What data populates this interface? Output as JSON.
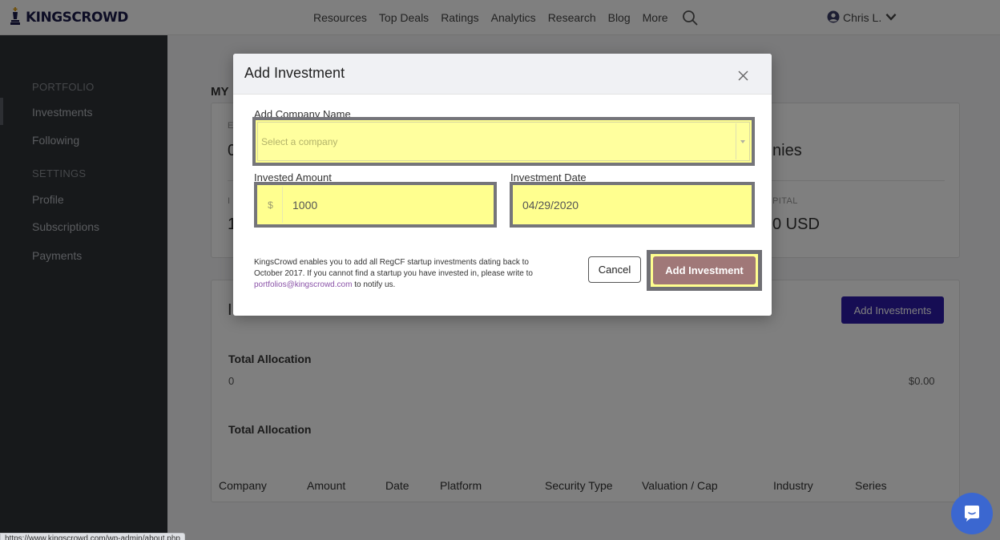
{
  "brand": {
    "logo_text": "KINGSCROWD"
  },
  "nav": {
    "links": [
      "Resources",
      "Top Deals",
      "Ratings",
      "Analytics",
      "Research",
      "Blog",
      "More"
    ],
    "user_name": "Chris L."
  },
  "sidebar": {
    "portfolio_heading": "PORTFOLIO",
    "portfolio_items": [
      "Investments",
      "Following"
    ],
    "settings_heading": "SETTINGS",
    "settings_items": [
      "Profile",
      "Subscriptions",
      "Payments"
    ]
  },
  "main": {
    "heading_partial": "MY",
    "stat1_label_partial": "E",
    "stat1_value_partial": "0",
    "stat2_value_partial": "nies",
    "stat3_label_partial": "I",
    "stat3_value_partial": "1",
    "stat4_label_partial": "PITAL",
    "stat4_value_partial": "0 USD",
    "section_letter": "I",
    "add_investments_label": "Add Investments",
    "total_allocation_1": "Total Allocation",
    "allocation_count": "0",
    "allocation_amount": "$0.00",
    "total_allocation_2": "Total Allocation",
    "table_headers": [
      "Company",
      "Amount",
      "Date",
      "Platform",
      "Security Type",
      "Valuation / Cap",
      "Industry",
      "Series"
    ]
  },
  "modal": {
    "title": "Add Investment",
    "company_label": "Add Company Name",
    "company_placeholder": "Select a company",
    "amount_label": "Invested Amount",
    "amount_prefix": "$",
    "amount_value": "1000",
    "date_label": "Investment Date",
    "date_value": "04/29/2020",
    "note_text": "KingsCrowd enables you to add all RegCF startup investments dating back to October 2017. If you cannot find a startup you have invested in, please write to ",
    "note_email": "portfolios@kingscrowd.com",
    "note_suffix": " to notify us.",
    "cancel_label": "Cancel",
    "submit_label": "Add Investment"
  },
  "status_url": "https://www.kingscrowd.com/wp-admin/about.php",
  "colors": {
    "highlight": "#ffff8f",
    "primary_button": "#2c1ba8",
    "sidebar_bg": "#2f3236",
    "submit_button": "#a07878"
  },
  "icons": [
    "king-chess-icon",
    "search-icon",
    "user-circle-icon",
    "chevron-down-icon",
    "close-icon",
    "caret-down-icon",
    "chat-icon"
  ]
}
